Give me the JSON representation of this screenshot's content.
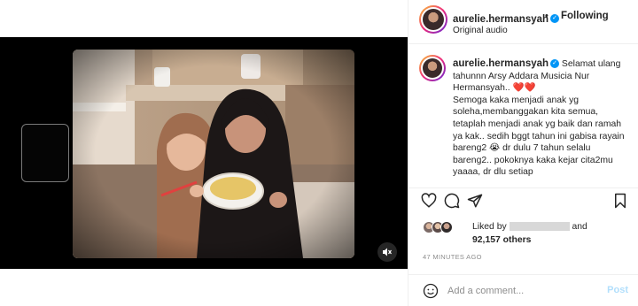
{
  "header": {
    "username": "aurelie.hermansyah",
    "separator": "•",
    "follow_label": "Following",
    "audio_label": "Original audio"
  },
  "caption": {
    "username": "aurelie.hermansyah",
    "text": "Selamat ulang tahunnn Arsy Addara Musicia Nur Hermansyah..",
    "body": "Semoga kaka menjadi anak yg soleha,membanggakan kita semua, tetaplah menjadi anak yg baik dan ramah ya kak.. sedih bggt tahun ini gabisa rayain bareng2",
    "body2": "dr dulu 7 tahun selalu bareng2.. pokoknya kaka kejar cita2mu yaaaa, dr dlu setiap"
  },
  "likes": {
    "liked_by_prefix": "Liked by",
    "and_word": "and",
    "count": "92,157 others"
  },
  "timeago": "47 MINUTES AGO",
  "comment": {
    "placeholder": "Add a comment...",
    "post_label": "Post"
  },
  "icons": {
    "like": "heart-icon",
    "comment": "comment-icon",
    "share": "paper-plane-icon",
    "save": "bookmark-icon",
    "mute": "speaker-muted-icon",
    "emoji": "smiley-icon"
  },
  "colors": {
    "accent_blue": "#0095f6",
    "post_disabled": "#b2dffc",
    "heart_red": "#ed4956"
  }
}
